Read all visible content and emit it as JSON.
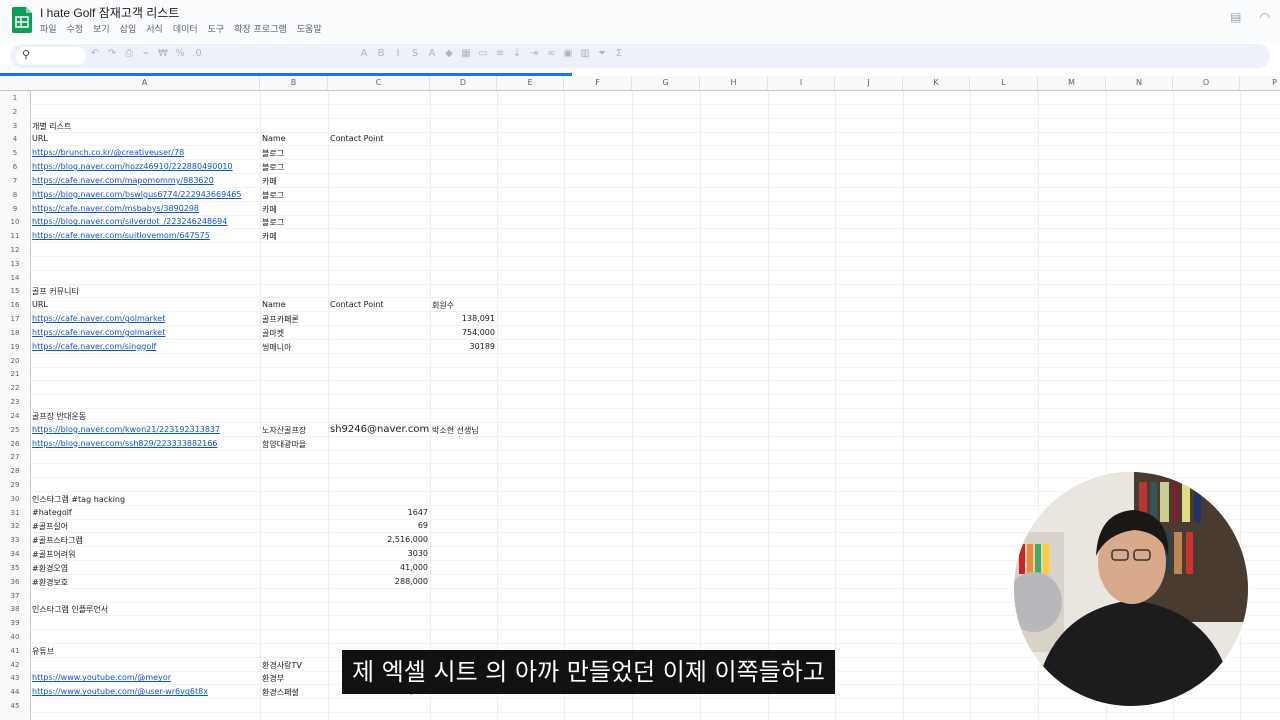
{
  "app": {
    "title": "I hate Golf 잠재고객 리스트"
  },
  "menu": [
    "파일",
    "수정",
    "보기",
    "삽입",
    "서식",
    "데이터",
    "도구",
    "확장 프로그램",
    "도움말"
  ],
  "toolbar": {
    "icons": [
      "undo-icon",
      "redo-icon",
      "print-icon",
      "paint-format-icon",
      "currency-icon",
      "percent-icon",
      "decimal-icon",
      "font-icon",
      "bold-icon",
      "italic-icon",
      "strikethrough-icon",
      "text-color-icon",
      "fill-color-icon",
      "borders-icon",
      "merge-icon",
      "align-icon",
      "valign-icon",
      "wrap-icon",
      "link-icon",
      "comment-icon",
      "chart-icon",
      "filter-icon",
      "functions-icon"
    ]
  },
  "columns": [
    "A",
    "B",
    "C",
    "D",
    "E",
    "F",
    "G",
    "H",
    "I",
    "J",
    "K",
    "L",
    "M",
    "N",
    "O",
    "P"
  ],
  "rows": [
    1,
    2,
    3,
    4,
    5,
    6,
    7,
    8,
    9,
    10,
    11,
    12,
    13,
    14,
    15,
    16,
    17,
    18,
    19,
    20,
    21,
    22,
    23,
    24,
    25,
    26,
    27,
    28,
    29,
    30,
    31,
    32,
    33,
    34,
    35,
    36,
    37,
    38,
    39,
    40,
    41,
    42,
    43,
    44,
    45
  ],
  "cells": [
    {
      "r": 3,
      "c": "A",
      "t": "개별 리스트"
    },
    {
      "r": 4,
      "c": "A",
      "t": " URL"
    },
    {
      "r": 4,
      "c": "B",
      "t": "Name"
    },
    {
      "r": 4,
      "c": "C",
      "t": "Contact Point"
    },
    {
      "r": 5,
      "c": "A",
      "t": "https://brunch.co.kr/@creativeuser/78",
      "link": true
    },
    {
      "r": 5,
      "c": "B",
      "t": "블로그"
    },
    {
      "r": 6,
      "c": "A",
      "t": "https://blog.naver.com/hozz46910/222880490010",
      "link": true
    },
    {
      "r": 6,
      "c": "B",
      "t": "블로그"
    },
    {
      "r": 7,
      "c": "A",
      "t": "https://cafe.naver.com/mapomommy/883620",
      "link": true
    },
    {
      "r": 7,
      "c": "B",
      "t": "카페"
    },
    {
      "r": 8,
      "c": "A",
      "t": "https://blog.naver.com/bswlgus6774/222943669465",
      "link": true
    },
    {
      "r": 8,
      "c": "B",
      "t": "블로그"
    },
    {
      "r": 9,
      "c": "A",
      "t": "https://cafe.naver.com/msbabys/3890298",
      "link": true
    },
    {
      "r": 9,
      "c": "B",
      "t": "카페"
    },
    {
      "r": 10,
      "c": "A",
      "t": "https://blog.naver.com/silverdot_/223246248694",
      "link": true
    },
    {
      "r": 10,
      "c": "B",
      "t": "블로그"
    },
    {
      "r": 11,
      "c": "A",
      "t": "https://cafe.naver.com/suitlovemom/647575",
      "link": true
    },
    {
      "r": 11,
      "c": "B",
      "t": "카페"
    },
    {
      "r": 15,
      "c": "A",
      "t": "골프 커뮤니티"
    },
    {
      "r": 16,
      "c": "A",
      "t": "URL"
    },
    {
      "r": 16,
      "c": "B",
      "t": "Name"
    },
    {
      "r": 16,
      "c": "C",
      "t": "Contact Point"
    },
    {
      "r": 16,
      "c": "D",
      "t": "회원수"
    },
    {
      "r": 17,
      "c": "A",
      "t": "https://cafe.naver.com/golmarket",
      "link": true
    },
    {
      "r": 17,
      "c": "B",
      "t": "골프카페론"
    },
    {
      "r": 17,
      "c": "D",
      "t": "138,091",
      "num": true
    },
    {
      "r": 18,
      "c": "A",
      "t": "https://cafe.naver.com/golmarket",
      "link": true
    },
    {
      "r": 18,
      "c": "B",
      "t": "골마켓"
    },
    {
      "r": 18,
      "c": "D",
      "t": "754,000",
      "num": true
    },
    {
      "r": 19,
      "c": "A",
      "t": " https://cafe.naver.com/singgolf",
      "link": true
    },
    {
      "r": 19,
      "c": "B",
      "t": "씽매니아"
    },
    {
      "r": 19,
      "c": "D",
      "t": "30189",
      "num": true
    },
    {
      "r": 24,
      "c": "A",
      "t": " 골프장 반대운동"
    },
    {
      "r": 25,
      "c": "A",
      "t": "https://blog.naver.com/kwon21/223192313837",
      "link": true
    },
    {
      "r": 25,
      "c": "B",
      "t": "노자산골프장"
    },
    {
      "r": 25,
      "c": "C",
      "t": "sh9246@naver.com",
      "big": true
    },
    {
      "r": 25,
      "c": "D",
      "t": "박소현 선생님"
    },
    {
      "r": 26,
      "c": "A",
      "t": "https://blog.naver.com/ssh829/223333882166",
      "link": true
    },
    {
      "r": 26,
      "c": "B",
      "t": "함양대광마을"
    },
    {
      "r": 30,
      "c": "A",
      "t": "인스타그램 #tag hacking"
    },
    {
      "r": 31,
      "c": "A",
      "t": "#hategolf"
    },
    {
      "r": 31,
      "c": "C",
      "t": "1647",
      "num": true
    },
    {
      "r": 32,
      "c": "A",
      "t": "#골프실어"
    },
    {
      "r": 32,
      "c": "C",
      "t": "69",
      "num": true
    },
    {
      "r": 33,
      "c": "A",
      "t": "#골프스타그램"
    },
    {
      "r": 33,
      "c": "C",
      "t": "2,516,000",
      "num": true
    },
    {
      "r": 34,
      "c": "A",
      "t": " #골프어려워"
    },
    {
      "r": 34,
      "c": "C",
      "t": "3030",
      "num": true
    },
    {
      "r": 35,
      "c": "A",
      "t": "#환경오염"
    },
    {
      "r": 35,
      "c": "C",
      "t": "41,000",
      "num": true
    },
    {
      "r": 36,
      "c": "A",
      "t": "#환경보호"
    },
    {
      "r": 36,
      "c": "C",
      "t": "288,000",
      "num": true
    },
    {
      "r": 38,
      "c": "A",
      "t": "인스타그램 인플루언서"
    },
    {
      "r": 41,
      "c": "A",
      "t": "유튜브"
    },
    {
      "r": 42,
      "c": "B",
      "t": "환경사랑TV"
    },
    {
      "r": 43,
      "c": "A",
      "t": "https://www.youtube.com/@meyor",
      "link": true
    },
    {
      "r": 43,
      "c": "B",
      "t": "환경부"
    },
    {
      "r": 44,
      "c": "A",
      "t": "https://www.youtube.com/@user-wr6vq6t8x",
      "link": true
    },
    {
      "r": 44,
      "c": "B",
      "t": "환경스페셜"
    },
    {
      "r": 44,
      "c": "C",
      "t": "176,000",
      "num": true
    }
  ],
  "subtitle": "제 엑셀 시트 의 아까 만들었던 이제 이쪽들하고"
}
